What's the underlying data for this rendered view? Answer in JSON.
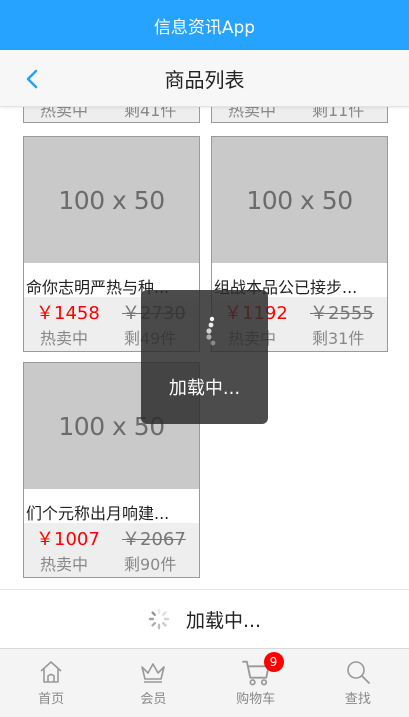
{
  "app": {
    "title": "信息资讯App"
  },
  "nav": {
    "title": "商品列表"
  },
  "products": [
    {
      "name": "命你志明严热与种...",
      "price": "￥1458",
      "old_price": "￥2730",
      "status": "热卖中",
      "stock": "剩49件",
      "image_label": "100 x 50"
    },
    {
      "name": "组战本品公已接步...",
      "price": "￥1192",
      "old_price": "￥2555",
      "status": "热卖中",
      "stock": "剩31件",
      "image_label": "100 x 50"
    },
    {
      "name": "们个元称出月响建...",
      "price": "￥1007",
      "old_price": "￥2067",
      "status": "热卖中",
      "stock": "剩90件",
      "image_label": "100 x 50"
    }
  ],
  "partial_row": {
    "left_status": "热卖中",
    "left_stock": "剩41件",
    "right_status": "热卖中",
    "right_stock": "剩11件"
  },
  "loading": {
    "toast_text": "加载中...",
    "loadmore_text": "加载中..."
  },
  "tabbar": {
    "items": [
      {
        "label": "首页",
        "icon": "home-icon"
      },
      {
        "label": "会员",
        "icon": "crown-icon"
      },
      {
        "label": "购物车",
        "icon": "cart-icon"
      },
      {
        "label": "查找",
        "icon": "search-icon"
      }
    ],
    "cart_badge": "9"
  },
  "colors": {
    "primary": "#26a2ff",
    "price": "#ff0000",
    "badge": "#ff0000"
  }
}
